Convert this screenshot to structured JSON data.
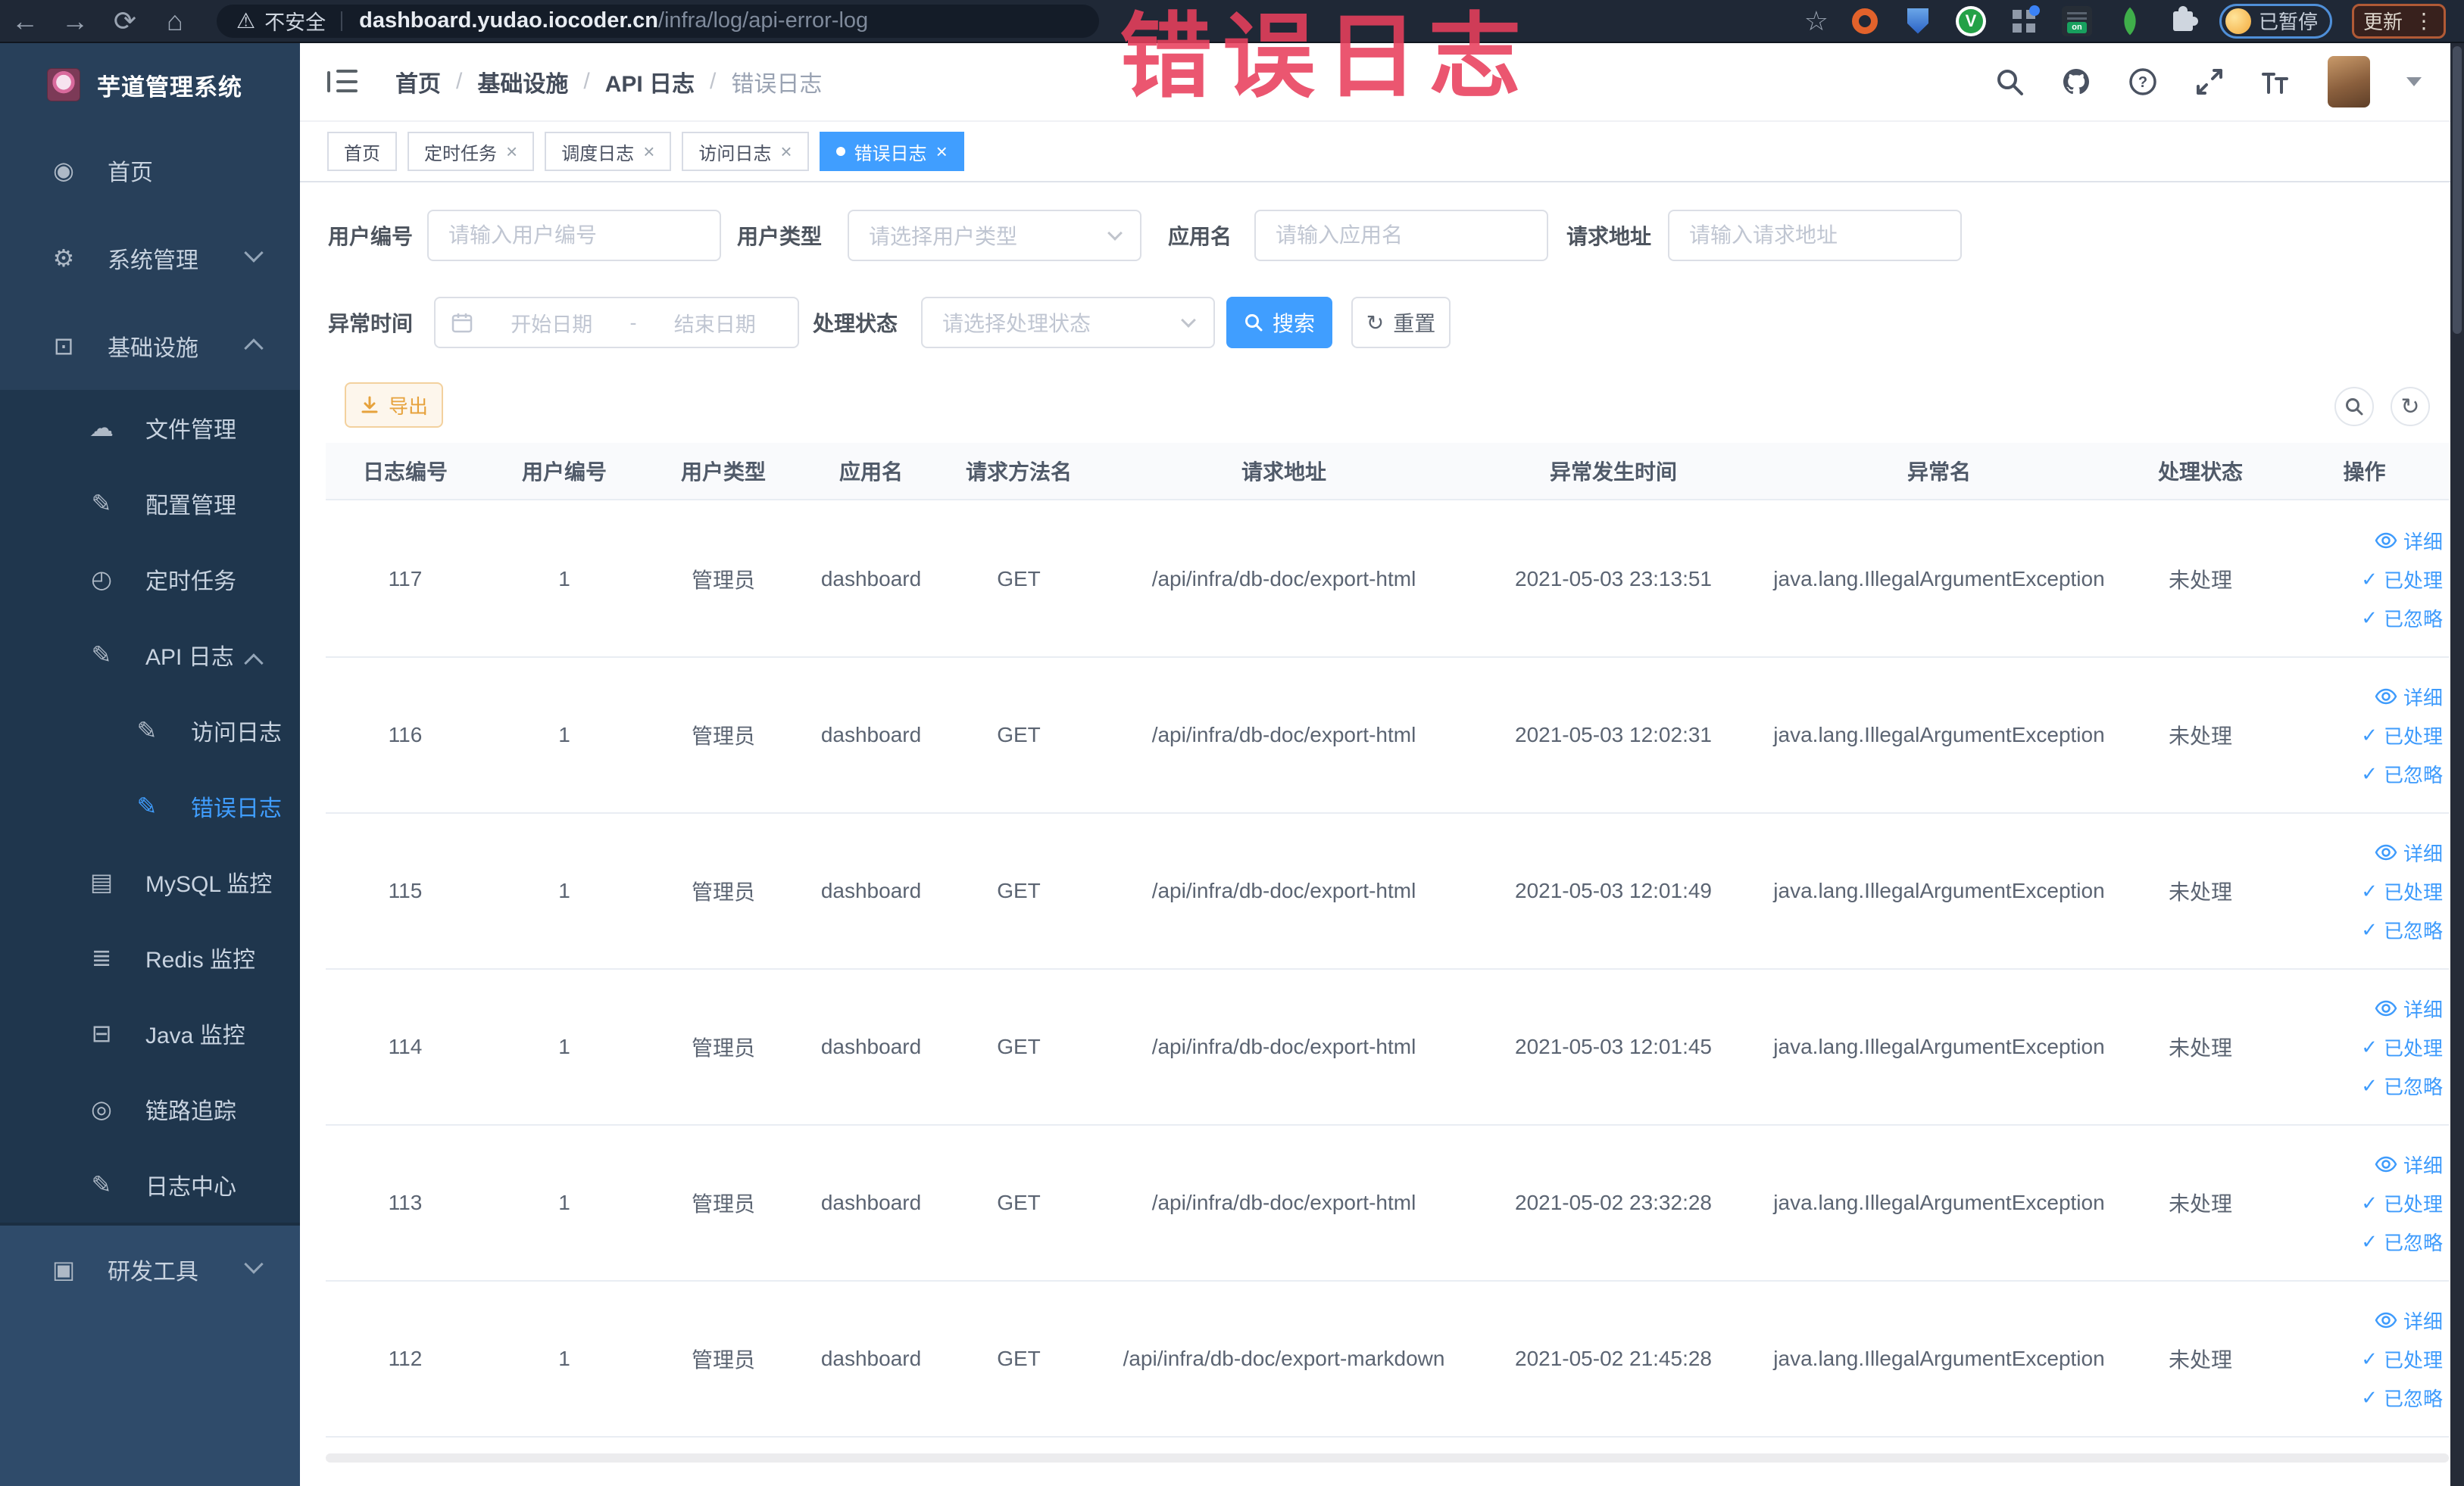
{
  "colors": {
    "accent": "#409eff",
    "warning": "#e6a23c",
    "annotation": "#e83f5c",
    "sidebar_active": "#409eff"
  },
  "annotation": {
    "text": "错误日志"
  },
  "icons": {
    "back": "←",
    "forward": "→",
    "reload": "⟳",
    "home": "⌂",
    "warning": "⚠",
    "star": "☆",
    "dots": "⋮",
    "close": "×",
    "check": "✓",
    "refresh": "↻"
  },
  "browser": {
    "security_label": "不安全",
    "url_host": "dashboard.yudao.iocoder.cn",
    "url_path": "/infra/log/api-error-log",
    "profile_badge": "已暂停",
    "update_button": "更新"
  },
  "sidebar": {
    "title": "芋道管理系统",
    "menu": [
      {
        "name": "home",
        "label": "首页",
        "glyph": "◉",
        "level": 1,
        "section": "top"
      },
      {
        "name": "system-mgmt",
        "label": "系统管理",
        "glyph": "⚙",
        "level": 1,
        "section": "top",
        "chevron": "down"
      },
      {
        "name": "infrastructure",
        "label": "基础设施",
        "glyph": "⊡",
        "level": 1,
        "section": "top",
        "chevron": "up"
      },
      {
        "name": "file-mgmt",
        "label": "文件管理",
        "glyph": "☁",
        "level": 2,
        "section": "sub"
      },
      {
        "name": "config-mgmt",
        "label": "配置管理",
        "glyph": "✎",
        "level": 2,
        "section": "sub"
      },
      {
        "name": "cron-jobs",
        "label": "定时任务",
        "glyph": "◴",
        "level": 2,
        "section": "sub"
      },
      {
        "name": "api-logs",
        "label": "API 日志",
        "glyph": "✎",
        "level": 2,
        "section": "sub",
        "chevron": "up"
      },
      {
        "name": "access-logs",
        "label": "访问日志",
        "glyph": "✎",
        "level": 3,
        "section": "sub"
      },
      {
        "name": "error-logs",
        "label": "错误日志",
        "glyph": "✎",
        "level": 3,
        "section": "sub",
        "active": true
      },
      {
        "name": "mysql-monitor",
        "label": "MySQL 监控",
        "glyph": "▤",
        "level": 2,
        "section": "sub"
      },
      {
        "name": "redis-monitor",
        "label": "Redis 监控",
        "glyph": "≣",
        "level": 2,
        "section": "sub"
      },
      {
        "name": "java-monitor",
        "label": "Java 监控",
        "glyph": "⊟",
        "level": 2,
        "section": "sub"
      },
      {
        "name": "trace",
        "label": "链路追踪",
        "glyph": "◎",
        "level": 2,
        "section": "sub"
      },
      {
        "name": "log-center",
        "label": "日志中心",
        "glyph": "✎",
        "level": 2,
        "section": "sub"
      },
      {
        "name": "dev-tools",
        "label": "研发工具",
        "glyph": "▣",
        "level": 1,
        "section": "bottom",
        "chevron": "down"
      }
    ]
  },
  "breadcrumb": {
    "items": [
      "首页",
      "基础设施",
      "API 日志",
      "错误日志"
    ]
  },
  "tabs": [
    {
      "label": "首页",
      "closable": false,
      "active": false
    },
    {
      "label": "定时任务",
      "closable": true,
      "active": false
    },
    {
      "label": "调度日志",
      "closable": true,
      "active": false
    },
    {
      "label": "访问日志",
      "closable": true,
      "active": false
    },
    {
      "label": "错误日志",
      "closable": true,
      "active": true
    }
  ],
  "filters": {
    "user_id": {
      "label": "用户编号",
      "placeholder": "请输入用户编号"
    },
    "user_type": {
      "label": "用户类型",
      "placeholder": "请选择用户类型"
    },
    "app_name": {
      "label": "应用名",
      "placeholder": "请输入应用名"
    },
    "request_url": {
      "label": "请求地址",
      "placeholder": "请输入请求地址"
    },
    "exception_time": {
      "label": "异常时间",
      "start_placeholder": "开始日期",
      "separator": "-",
      "end_placeholder": "结束日期"
    },
    "process_status": {
      "label": "处理状态",
      "placeholder": "请选择处理状态"
    },
    "search_button": "搜索",
    "reset_button": "重置"
  },
  "toolbar": {
    "export_button": "导出"
  },
  "table": {
    "columns": [
      "日志编号",
      "用户编号",
      "用户类型",
      "应用名",
      "请求方法名",
      "请求地址",
      "异常发生时间",
      "异常名",
      "处理状态",
      "操作"
    ],
    "ops": {
      "detail": "详细",
      "processed": "已处理",
      "ignored": "已忽略"
    },
    "rows": [
      {
        "id": "117",
        "user_id": "1",
        "user_type": "管理员",
        "app": "dashboard",
        "method": "GET",
        "url": "/api/infra/db-doc/export-html",
        "time": "2021-05-03 23:13:51",
        "exception": "java.lang.IllegalArgumentException",
        "status": "未处理"
      },
      {
        "id": "116",
        "user_id": "1",
        "user_type": "管理员",
        "app": "dashboard",
        "method": "GET",
        "url": "/api/infra/db-doc/export-html",
        "time": "2021-05-03 12:02:31",
        "exception": "java.lang.IllegalArgumentException",
        "status": "未处理"
      },
      {
        "id": "115",
        "user_id": "1",
        "user_type": "管理员",
        "app": "dashboard",
        "method": "GET",
        "url": "/api/infra/db-doc/export-html",
        "time": "2021-05-03 12:01:49",
        "exception": "java.lang.IllegalArgumentException",
        "status": "未处理"
      },
      {
        "id": "114",
        "user_id": "1",
        "user_type": "管理员",
        "app": "dashboard",
        "method": "GET",
        "url": "/api/infra/db-doc/export-html",
        "time": "2021-05-03 12:01:45",
        "exception": "java.lang.IllegalArgumentException",
        "status": "未处理"
      },
      {
        "id": "113",
        "user_id": "1",
        "user_type": "管理员",
        "app": "dashboard",
        "method": "GET",
        "url": "/api/infra/db-doc/export-html",
        "time": "2021-05-02 23:32:28",
        "exception": "java.lang.IllegalArgumentException",
        "status": "未处理"
      },
      {
        "id": "112",
        "user_id": "1",
        "user_type": "管理员",
        "app": "dashboard",
        "method": "GET",
        "url": "/api/infra/db-doc/export-markdown",
        "time": "2021-05-02 21:45:28",
        "exception": "java.lang.IllegalArgumentException",
        "status": "未处理"
      }
    ]
  }
}
